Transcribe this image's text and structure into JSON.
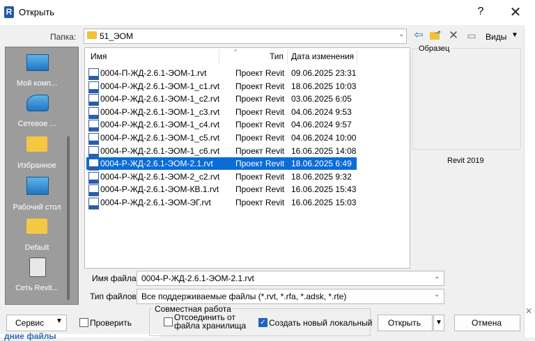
{
  "window": {
    "app_logo": "R",
    "title": "Открыть",
    "help": "?",
    "close": "✕"
  },
  "toolbar": {
    "folder_label": "Папка:",
    "folder_value": "51_ЭОМ",
    "views_label": "Виды",
    "icons": [
      "back-arrow-icon",
      "up-folder-icon",
      "delete-icon",
      "views-icon"
    ]
  },
  "places": [
    {
      "label": "Мой комп...",
      "icon": "computer-icon"
    },
    {
      "label": "Сетевое ...",
      "icon": "network-icon"
    },
    {
      "label": "Избранное",
      "icon": "folder-icon"
    },
    {
      "label": "Рабочий стол",
      "icon": "desktop-icon"
    },
    {
      "label": "Default",
      "icon": "folder-icon"
    },
    {
      "label": "Сеть Revit...",
      "icon": "revit-network-icon"
    }
  ],
  "file_list": {
    "columns": {
      "name": "Имя",
      "type": "Тип",
      "date": "Дата изменения"
    },
    "rows": [
      {
        "name": "0004-П-ЖД-2.6.1-ЭОМ-1.rvt",
        "type": "Проект Revit",
        "date": "09.06.2025 23:31"
      },
      {
        "name": "0004-Р-ЖД-2.6.1-ЭОМ-1_с1.rvt",
        "type": "Проект Revit",
        "date": "18.06.2025 10:03"
      },
      {
        "name": "0004-Р-ЖД-2.6.1-ЭОМ-1_с2.rvt",
        "type": "Проект Revit",
        "date": "03.06.2025 6:05"
      },
      {
        "name": "0004-Р-ЖД-2.6.1-ЭОМ-1_с3.rvt",
        "type": "Проект Revit",
        "date": "04.06.2024 9:53"
      },
      {
        "name": "0004-Р-ЖД-2.6.1-ЭОМ-1_с4.rvt",
        "type": "Проект Revit",
        "date": "04.06.2024 9:57"
      },
      {
        "name": "0004-Р-ЖД-2.6.1-ЭОМ-1_с5.rvt",
        "type": "Проект Revit",
        "date": "04.06.2024 10:00"
      },
      {
        "name": "0004-Р-ЖД-2.6.1-ЭОМ-1_с6.rvt",
        "type": "Проект Revit",
        "date": "16.06.2025 14:08"
      },
      {
        "name": "0004-Р-ЖД-2.6.1-ЭОМ-2.1.rvt",
        "type": "Проект Revit",
        "date": "18.06.2025 6:49",
        "selected": true
      },
      {
        "name": "0004-Р-ЖД-2.6.1-ЭОМ-2_с2.rvt",
        "type": "Проект Revit",
        "date": "18.06.2025 9:32"
      },
      {
        "name": "0004-Р-ЖД-2.6.1-ЭОМ-КВ.1.rvt",
        "type": "Проект Revit",
        "date": "16.06.2025 15:43"
      },
      {
        "name": "0004-Р-ЖД-2.6.1-ЭОМ-ЭГ.rvt",
        "type": "Проект Revit",
        "date": "16.06.2025 15:03"
      }
    ]
  },
  "preview": {
    "label": "Образец",
    "version": "Revit 2019"
  },
  "fields": {
    "filename_label": "Имя файла:",
    "filename_value": "0004-Р-ЖД-2.6.1-ЭОМ-2.1.rvt",
    "filetype_label": "Тип файлов:",
    "filetype_value": "Все поддерживаемые файлы  (*.rvt, *.rfa, *.adsk, *.rte)"
  },
  "bottom": {
    "service": "Сервис",
    "verify": "Проверить",
    "workshare_legend": "Совместная работа",
    "detach_line1": "Отсоединить от",
    "detach_line2": "файла хранилища",
    "create_local": "Создать новый локальный",
    "create_local_checked": true,
    "verify_checked": false,
    "detach_checked": false,
    "open": "Открыть",
    "cancel": "Отмена"
  },
  "background": {
    "partial_text": "дние файлы"
  },
  "colors": {
    "selection": "#0a6cd6",
    "places_bg": "#9c9c9c",
    "accent": "#1f62c4"
  }
}
